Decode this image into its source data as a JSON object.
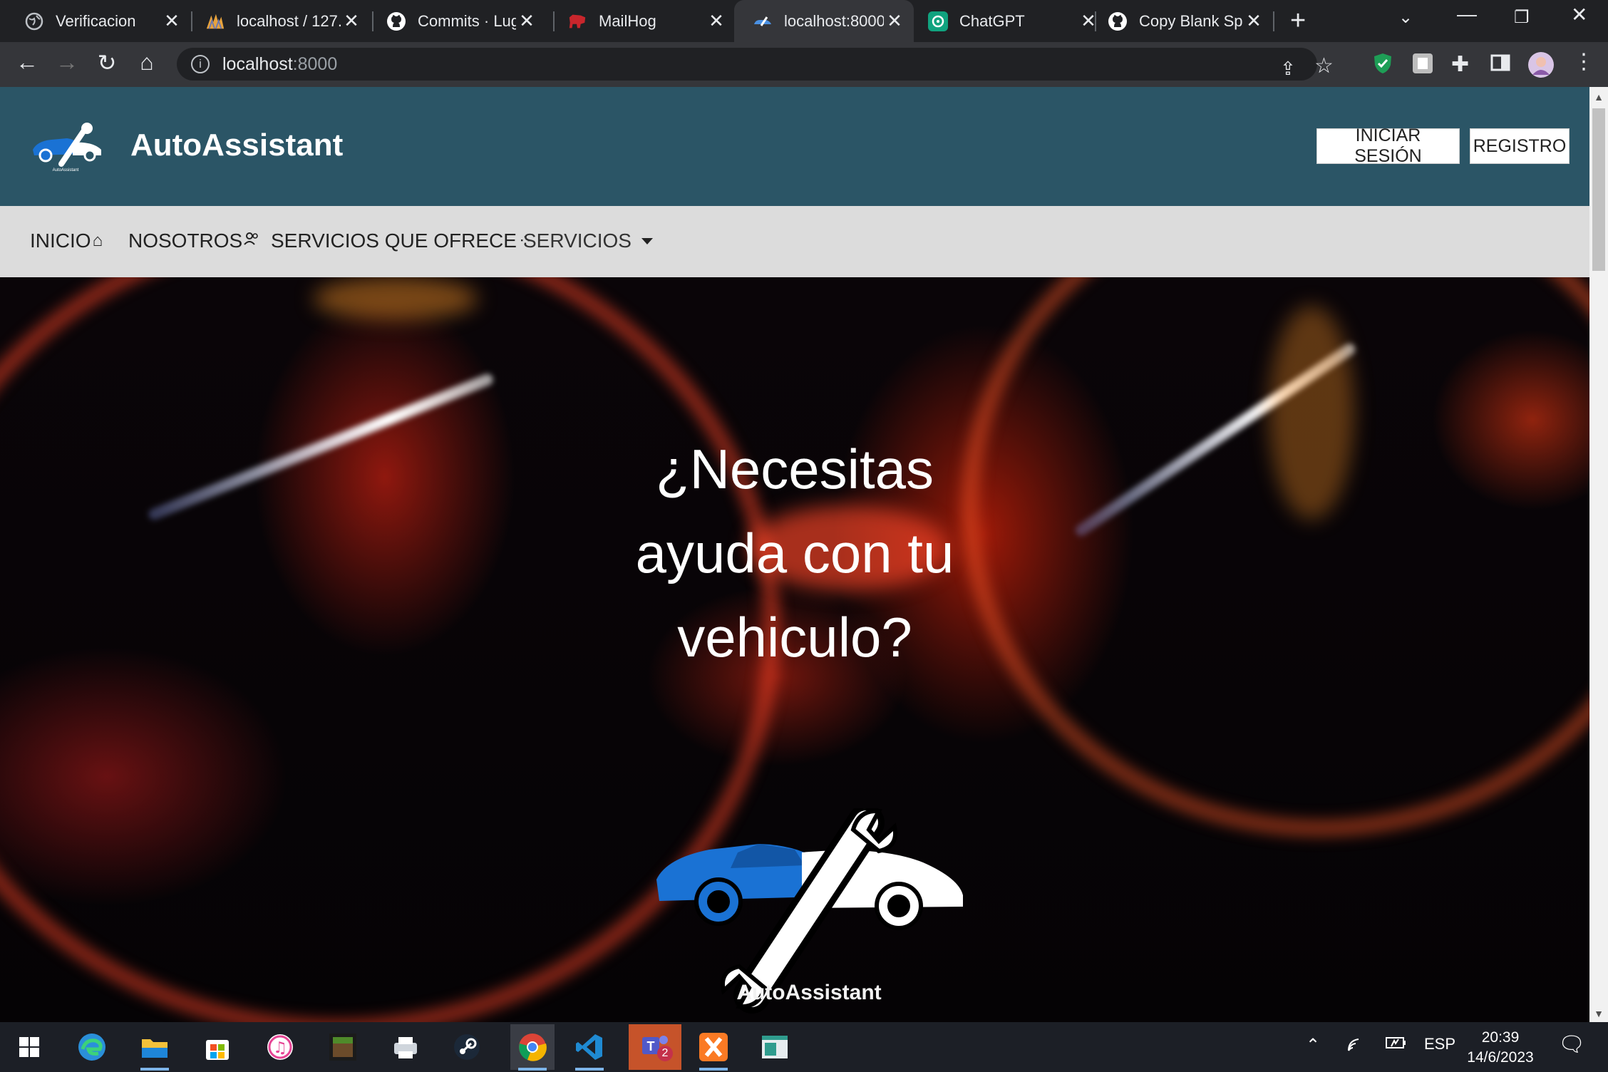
{
  "browser": {
    "tabs": [
      {
        "title": "Verificacion",
        "icon": "globe-icon",
        "active": false
      },
      {
        "title": "localhost / 127.",
        "icon": "phpmyadmin-icon",
        "active": false
      },
      {
        "title": "Commits · Lugu",
        "icon": "github-icon",
        "active": false
      },
      {
        "title": "MailHog",
        "icon": "pig-icon",
        "active": false
      },
      {
        "title": "localhost:8000",
        "icon": "car-icon",
        "active": true
      },
      {
        "title": "ChatGPT",
        "icon": "chatgpt-icon",
        "active": false
      },
      {
        "title": "Copy Blank Spa",
        "icon": "github-icon",
        "active": false
      }
    ],
    "url_host": "localhost",
    "url_port": ":8000"
  },
  "site": {
    "brand": "AutoAssistant",
    "login_label": "INICIAR SESIÓN",
    "register_label": "REGISTRO",
    "nav": [
      {
        "label": "INICIO",
        "icon": "home-icon"
      },
      {
        "label": "NOSOTROS",
        "icon": "users-icon"
      },
      {
        "label": "SERVICIOS QUE OFRECE",
        "icon": "loading-icon"
      },
      {
        "label": "SERVICIOS",
        "icon": "caret-down-icon"
      }
    ],
    "hero_headline": "¿Necesitas ayuda con tu vehiculo?",
    "hero_logo_text": "AutoAssistant",
    "colors": {
      "header_bg": "#2b5566",
      "nav_bg": "#dcdcdc",
      "logo_blue": "#1a72d4"
    }
  },
  "taskbar": {
    "language": "ESP",
    "time": "20:39",
    "date": "14/6/2023",
    "teams_badge": "2"
  }
}
